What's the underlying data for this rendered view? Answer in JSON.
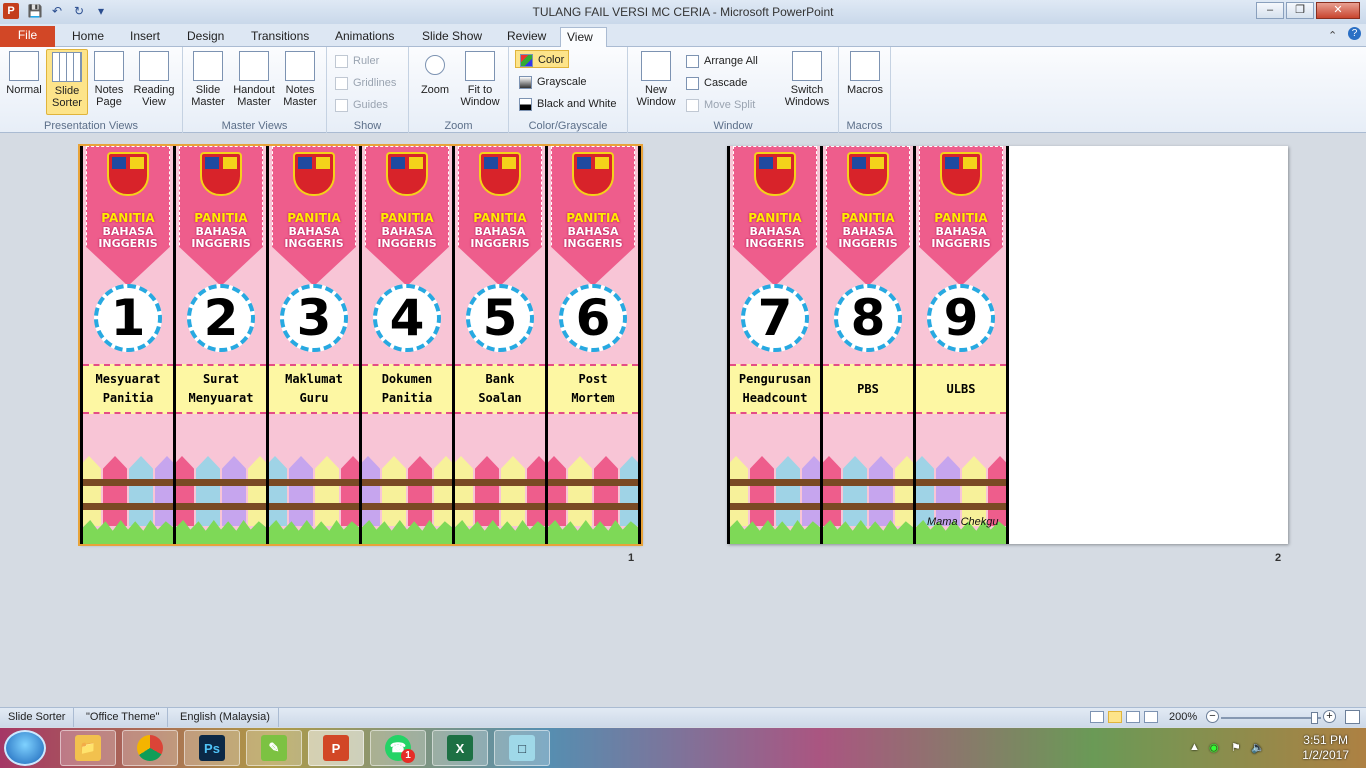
{
  "window": {
    "title": "TULANG FAIL VERSI MC CERIA  -  Microsoft PowerPoint",
    "app_icon": "P"
  },
  "tabs": [
    "File",
    "Home",
    "Insert",
    "Design",
    "Transitions",
    "Animations",
    "Slide Show",
    "Review",
    "View"
  ],
  "active_tab": "View",
  "ribbon": {
    "presentation_views": {
      "label": "Presentation Views",
      "buttons": [
        "Normal",
        "Slide Sorter",
        "Notes Page",
        "Reading View"
      ]
    },
    "master_views": {
      "label": "Master Views",
      "buttons": [
        "Slide Master",
        "Handout Master",
        "Notes Master"
      ]
    },
    "show": {
      "label": "Show",
      "items": [
        "Ruler",
        "Gridlines",
        "Guides"
      ]
    },
    "zoom": {
      "label": "Zoom",
      "buttons": [
        "Zoom",
        "Fit to Window"
      ]
    },
    "color_grayscale": {
      "label": "Color/Grayscale",
      "items": [
        "Color",
        "Grayscale",
        "Black and White"
      ]
    },
    "window": {
      "label": "Window",
      "new_window": "New Window",
      "items": [
        "Arrange All",
        "Cascade",
        "Move Split"
      ],
      "switch": "Switch Windows"
    },
    "macros": {
      "label": "Macros",
      "button": "Macros"
    }
  },
  "slides": [
    {
      "number": "1",
      "spines": [
        {
          "num": "1",
          "line1": "Mesyuarat",
          "line2": "Panitia"
        },
        {
          "num": "2",
          "line1": "Surat",
          "line2": "Menyuarat"
        },
        {
          "num": "3",
          "line1": "Maklumat",
          "line2": "Guru"
        },
        {
          "num": "4",
          "line1": "Dokumen",
          "line2": "Panitia"
        },
        {
          "num": "5",
          "line1": "Bank",
          "line2": "Soalan"
        },
        {
          "num": "6",
          "line1": "Post",
          "line2": "Mortem"
        }
      ]
    },
    {
      "number": "2",
      "spines": [
        {
          "num": "7",
          "line1": "Pengurusan",
          "line2": "Headcount"
        },
        {
          "num": "8",
          "line1": "PBS",
          "line2": ""
        },
        {
          "num": "9",
          "line1": "ULBS",
          "line2": ""
        }
      ],
      "credit": "Mama Chekgu"
    }
  ],
  "spine_header": {
    "line1": "PANITIA",
    "line2": "BAHASA",
    "line3": "INGGERIS"
  },
  "status": {
    "view": "Slide Sorter",
    "theme": "\"Office Theme\"",
    "language": "English (Malaysia)",
    "zoom": "200%"
  },
  "taskbar": {
    "time": "3:51 PM",
    "date": "1/2/2017",
    "apps": [
      "Windows Explorer",
      "Google Chrome",
      "Photoshop",
      "Pen tool",
      "PowerPoint",
      "WhatsApp",
      "Excel",
      "Notes"
    ],
    "whatsapp_badge": "1"
  },
  "colors": {
    "file_tab": "#d24726",
    "banner_pink": "#ee5d8c",
    "spine_bg": "#f8c5d6",
    "label_yellow": "#fdf7a3",
    "circle_border": "#27a9e1",
    "selected_button": "#fde48a"
  }
}
